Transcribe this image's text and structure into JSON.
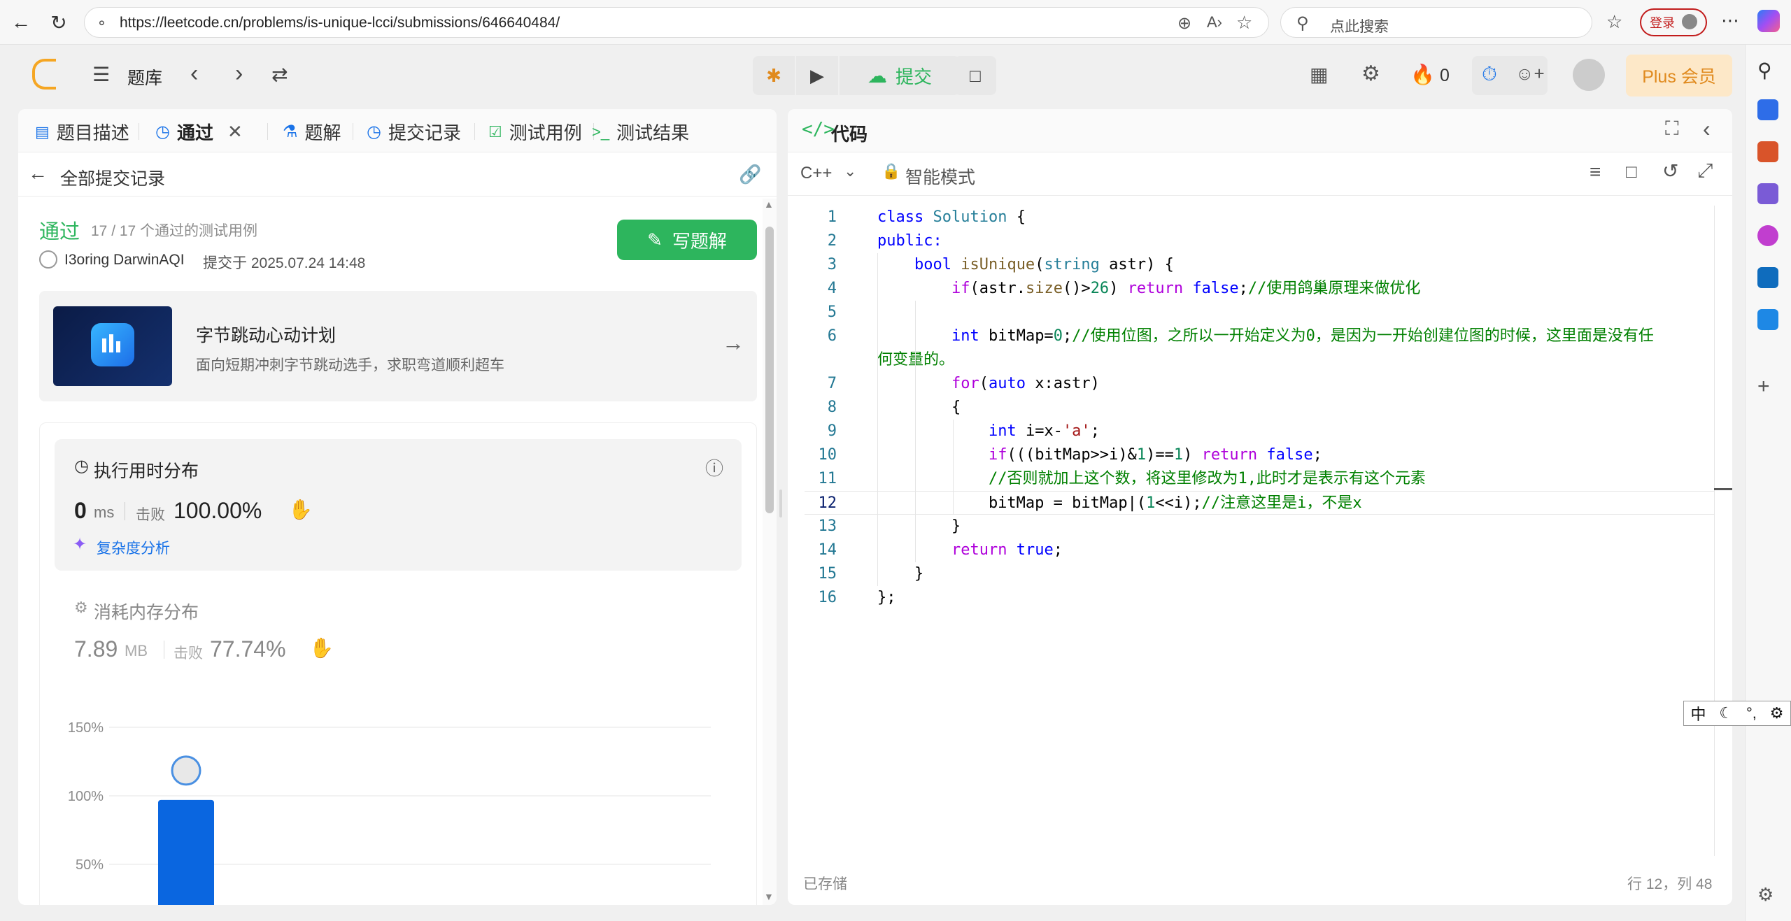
{
  "browser": {
    "url": "https://leetcode.cn/problems/is-unique-lcci/submissions/646640484/",
    "search_placeholder": "点此搜索",
    "login_label": "登录"
  },
  "header": {
    "problem_bank": "题库",
    "submit_label": "提交",
    "streak_count": "0",
    "plus_label": "Plus 会员"
  },
  "left_tabs": [
    {
      "label": "题目描述"
    },
    {
      "label": "通过"
    },
    {
      "label": "题解"
    },
    {
      "label": "提交记录"
    },
    {
      "label": "测试用例"
    },
    {
      "label": "测试结果"
    }
  ],
  "submission": {
    "back_label": "全部提交记录",
    "status": "通过",
    "testcases": "17 / 17 个通过的测试用例",
    "user": "I3oring DarwinAQI",
    "submitted_at": "提交于 2025.07.24 14:48",
    "write_solution_label": "写题解"
  },
  "promo": {
    "title": "字节跳动心动计划",
    "subtitle": "面向短期冲刺字节跳动选手，求职弯道顺利超车"
  },
  "runtime": {
    "title": "执行用时分布",
    "value": "0",
    "unit": "ms",
    "beats_label": "击败",
    "beats_value": "100.00%",
    "complexity_label": "复杂度分析"
  },
  "memory": {
    "title": "消耗内存分布",
    "value": "7.89",
    "unit": "MB",
    "beats_label": "击败",
    "beats_value": "77.74%"
  },
  "chart_data": {
    "type": "bar",
    "ytick_labels": [
      "150%",
      "100%",
      "50%"
    ],
    "ylim": [
      0,
      150
    ],
    "values": [
      97
    ],
    "color": "#0a66e0"
  },
  "editor": {
    "title": "代码",
    "language": "C++",
    "mode_label": "智能模式",
    "saved_label": "已存储",
    "cursor_pos": "行 12，列 48"
  },
  "code_lines": [
    {
      "n": "1"
    },
    {
      "n": "2"
    },
    {
      "n": "3"
    },
    {
      "n": "4"
    },
    {
      "n": "5"
    },
    {
      "n": "6"
    },
    {
      "n": "7"
    },
    {
      "n": "8"
    },
    {
      "n": "9"
    },
    {
      "n": "10"
    },
    {
      "n": "11"
    },
    {
      "n": "12"
    },
    {
      "n": "13"
    },
    {
      "n": "14"
    },
    {
      "n": "15"
    },
    {
      "n": "16"
    }
  ],
  "code": {
    "l1a": "class ",
    "l1b": "Solution",
    "l1c": " {",
    "l2": "public:",
    "l3a": "    ",
    "l3b": "bool",
    "l3c": " ",
    "l3d": "isUnique",
    "l3e": "(",
    "l3f": "string",
    "l3g": " astr) {",
    "l4a": "        ",
    "l4b": "if",
    "l4c": "(astr.",
    "l4d": "size",
    "l4e": "()>",
    "l4f": "26",
    "l4g": ") ",
    "l4h": "return",
    "l4i": " ",
    "l4j": "false",
    "l4k": ";",
    "l4l": "//使用鸽巢原理来做优化",
    "l6a": "        ",
    "l6b": "int",
    "l6c": " bitMap=",
    "l6d": "0",
    "l6e": ";",
    "l6f": "//使用位图，之所以一开始定义为0，是因为一开始创建位图的时候，这里面是没有任",
    "l6g": "何变量的。",
    "l7a": "        ",
    "l7b": "for",
    "l7c": "(",
    "l7d": "auto",
    "l7e": " x:astr)",
    "l8": "        {",
    "l9a": "            ",
    "l9b": "int",
    "l9c": " i=x-",
    "l9d": "'a'",
    "l9e": ";",
    "l10a": "            ",
    "l10b": "if",
    "l10c": "(((bitMap>>i)&",
    "l10d": "1",
    "l10e": ")==",
    "l10f": "1",
    "l10g": ") ",
    "l10h": "return",
    "l10i": " ",
    "l10j": "false",
    "l10k": ";",
    "l11a": "            ",
    "l11b": "//否则就加上这个数，将这里修改为1,此时才是表示有这个元素",
    "l12a": "            bitMap = bitMap|(",
    "l12b": "1",
    "l12c": "<<i);",
    "l12d": "//注意这里是i，不是x",
    "l13": "        }",
    "l14a": "        ",
    "l14b": "return",
    "l14c": " ",
    "l14d": "true",
    "l14e": ";",
    "l15": "    }",
    "l16": "};"
  },
  "ime": {
    "label": "中"
  }
}
